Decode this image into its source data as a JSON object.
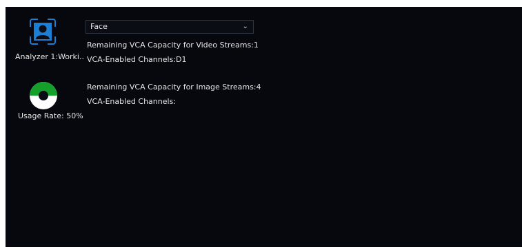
{
  "analyzer": {
    "icon": "person-icon",
    "label": "Analyzer 1:Worki.."
  },
  "usage": {
    "icon": "usage-gauge-icon",
    "rate_fraction": 0.5,
    "label": "Usage Rate: 50%"
  },
  "type_select": {
    "selected": "Face"
  },
  "video_streams": {
    "capacity_label": "Remaining VCA Capacity for Video Streams:",
    "capacity_value": "1",
    "channels_label": "VCA-Enabled Channels:",
    "channels_value": "D1"
  },
  "image_streams": {
    "capacity_label": "Remaining VCA Capacity for Image Streams:",
    "capacity_value": "4",
    "channels_label": "VCA-Enabled Channels:",
    "channels_value": ""
  },
  "colors": {
    "background": "#06080e",
    "accent_blue": "#1d7fd4",
    "usage_green": "#14a02a"
  }
}
